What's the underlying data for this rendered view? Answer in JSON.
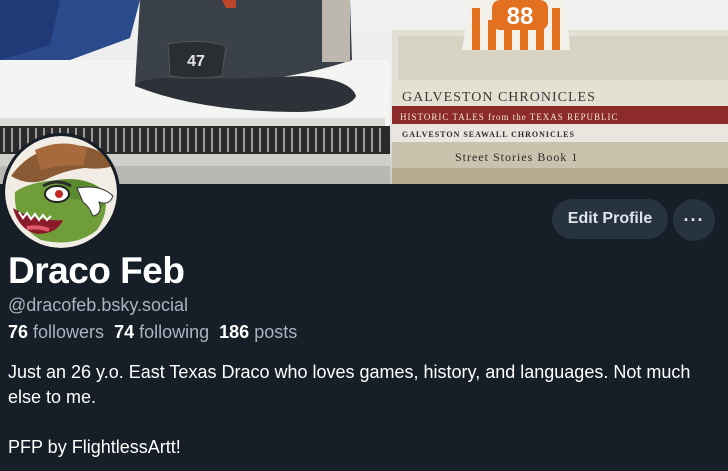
{
  "banner": {
    "books": [
      "GALVESTON CHRONICLES",
      "HISTORIC TALES from the TEXAS REPUBLIC",
      "GALVESTON SEAWALL CHRONICLES",
      "Street Stories Book 1"
    ],
    "sign_number": "88",
    "cap_badge": "47"
  },
  "profile": {
    "display_name": "Draco Feb",
    "handle": "@dracofeb.bsky.social",
    "followers_count": "76",
    "followers_label": "followers",
    "following_count": "74",
    "following_label": "following",
    "posts_count": "186",
    "posts_label": "posts",
    "bio_line1": "Just an 26 y.o. East Texas Draco who loves games, history, and languages. Not much else to me.",
    "bio_line2": "PFP by FlightlessArtt!"
  },
  "actions": {
    "edit_label": "Edit Profile",
    "more_label": "···"
  },
  "colors": {
    "background": "#161e27",
    "button": "#283341",
    "muted_text": "#aab4c0"
  }
}
